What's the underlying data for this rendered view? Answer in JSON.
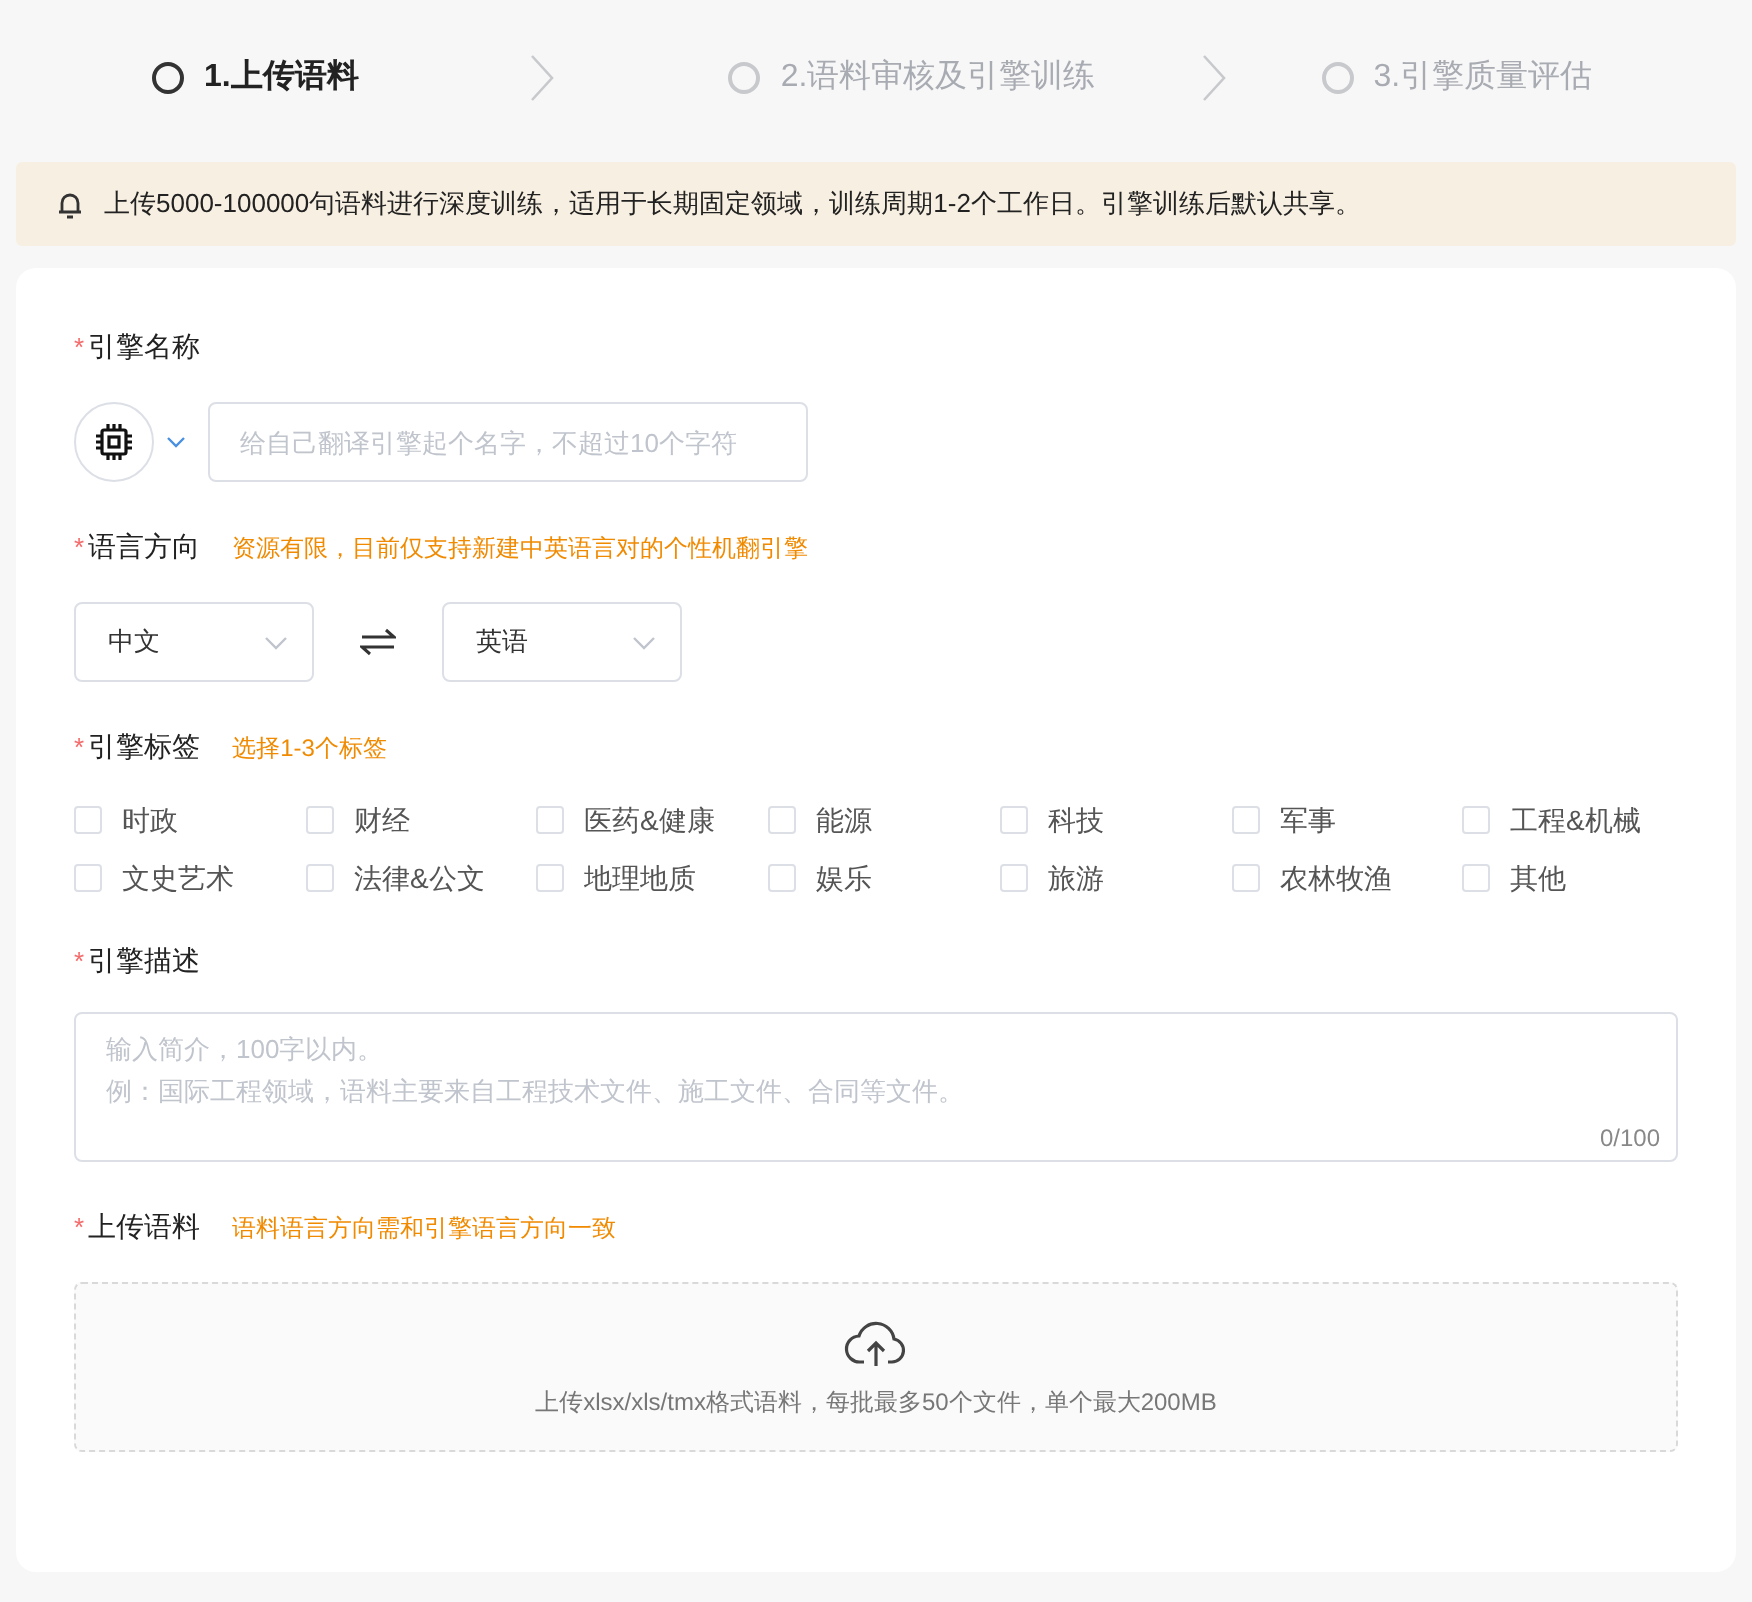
{
  "steps": [
    {
      "label": "1.上传语料",
      "selected": true
    },
    {
      "label": "2.语料审核及引擎训练",
      "selected": false
    },
    {
      "label": "3.引擎质量评估",
      "selected": false
    }
  ],
  "notice": {
    "text": "上传5000-100000句语料进行深度训练，适用于长期固定领域，训练周期1-2个工作日。引擎训练后默认共享。"
  },
  "form": {
    "name": {
      "required_mark": "*",
      "label": "引擎名称",
      "placeholder": "给自己翻译引擎起个名字，不超过10个字符"
    },
    "language": {
      "required_mark": "*",
      "label": "语言方向",
      "hint": "资源有限，目前仅支持新建中英语言对的个性机翻引擎",
      "source": "中文",
      "target": "英语"
    },
    "tags": {
      "required_mark": "*",
      "label": "引擎标签",
      "hint": "选择1-3个标签",
      "options": [
        {
          "label": "时政",
          "checked": false
        },
        {
          "label": "财经",
          "checked": false
        },
        {
          "label": "医药&健康",
          "checked": false
        },
        {
          "label": "能源",
          "checked": false
        },
        {
          "label": "科技",
          "checked": false
        },
        {
          "label": "军事",
          "checked": false
        },
        {
          "label": "工程&机械",
          "checked": false
        },
        {
          "label": "文史艺术",
          "checked": false
        },
        {
          "label": "法律&公文",
          "checked": false
        },
        {
          "label": "地理地质",
          "checked": false
        },
        {
          "label": "娱乐",
          "checked": false
        },
        {
          "label": "旅游",
          "checked": false
        },
        {
          "label": "农林牧渔",
          "checked": false
        },
        {
          "label": "其他",
          "checked": false
        }
      ]
    },
    "description": {
      "required_mark": "*",
      "label": "引擎描述",
      "placeholder_lines": [
        "输入简介，100字以内。",
        "例：国际工程领域，语料主要来自工程技术文件、施工文件、合同等文件。"
      ],
      "counter": "0/100"
    },
    "upload": {
      "required_mark": "*",
      "label": "上传语料",
      "hint": "语料语言方向需和引擎语言方向一致",
      "instructions": "上传xlsx/xls/tmx格式语料，每批最多50个文件，单个最大200MB"
    }
  }
}
